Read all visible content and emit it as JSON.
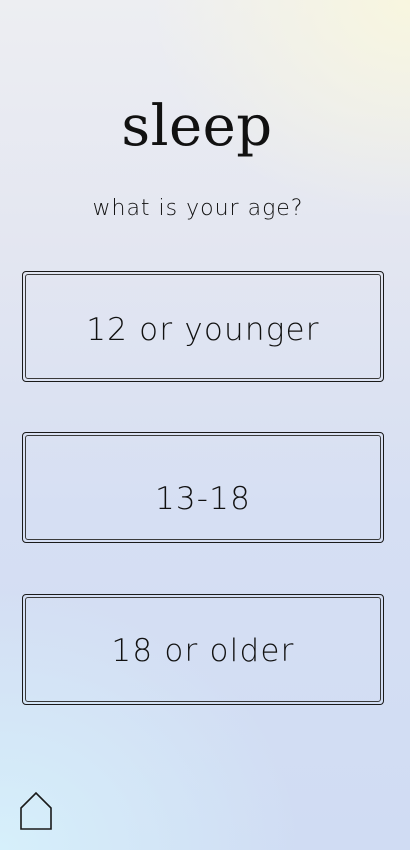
{
  "header": {
    "title": "sleep",
    "question": "what is your age?"
  },
  "options": [
    {
      "label": "12 or younger"
    },
    {
      "label": "13-18"
    },
    {
      "label": "18 or older"
    }
  ],
  "nav": {
    "home_icon": "home-icon"
  },
  "colors": {
    "text": "#111111",
    "border": "#1a1a1a",
    "bg_top": "#edeef2",
    "bg_bottom": "#d0dcf3",
    "accent_warm": "#f8f6df",
    "accent_cool": "#d6f0fb"
  }
}
